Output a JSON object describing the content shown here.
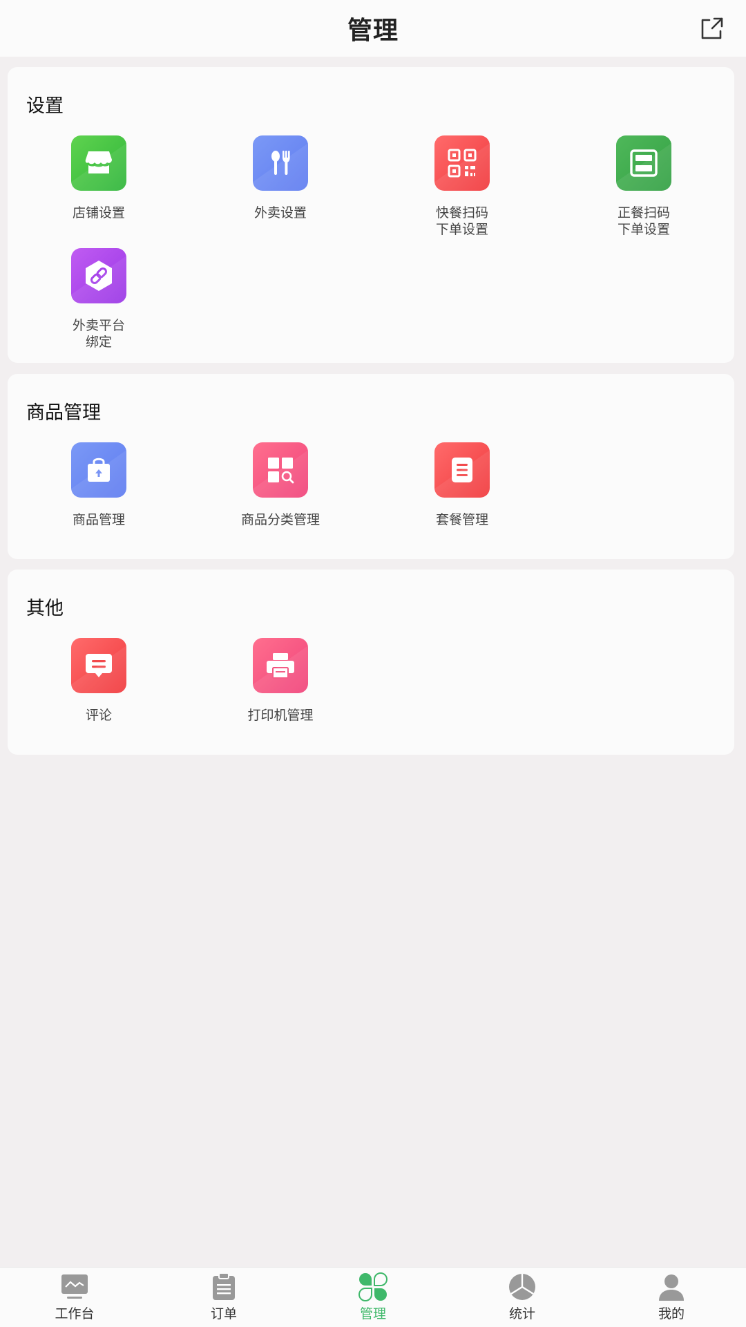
{
  "header": {
    "title": "管理",
    "share_icon": "share-icon"
  },
  "sections": [
    {
      "title": "设置",
      "items": [
        {
          "label": "店铺设置",
          "icon": "shop-icon",
          "color": "#3dc046"
        },
        {
          "label": "外卖设置",
          "icon": "spoon-fork-icon",
          "color": "#6f8cf4"
        },
        {
          "label": "快餐扫码\n下单设置",
          "icon": "qrcode-icon",
          "color": "#f5484b"
        },
        {
          "label": "正餐扫码\n下单设置",
          "icon": "scan-icon",
          "color": "#3fa94d"
        },
        {
          "label": "外卖平台\n绑定",
          "icon": "link-icon",
          "color": "#ac48ec"
        }
      ]
    },
    {
      "title": "商品管理",
      "items": [
        {
          "label": "商品管理",
          "icon": "bag-icon",
          "color": "#6f8cf4"
        },
        {
          "label": "商品分类管理",
          "icon": "category-search-icon",
          "color": "#f5557f"
        },
        {
          "label": "套餐管理",
          "icon": "list-doc-icon",
          "color": "#f5484b"
        }
      ]
    },
    {
      "title": "其他",
      "items": [
        {
          "label": "评论",
          "icon": "comment-icon",
          "color": "#f5484b"
        },
        {
          "label": "打印机管理",
          "icon": "printer-icon",
          "color": "#f5557f"
        }
      ]
    }
  ],
  "nav": [
    {
      "label": "工作台",
      "icon": "dashboard-icon",
      "active": false
    },
    {
      "label": "订单",
      "icon": "clipboard-icon",
      "active": false
    },
    {
      "label": "管理",
      "icon": "clover-icon",
      "active": true
    },
    {
      "label": "统计",
      "icon": "pie-chart-icon",
      "active": false
    },
    {
      "label": "我的",
      "icon": "user-icon",
      "active": false
    }
  ],
  "colors": {
    "accent": "#3fb86a",
    "background": "#f2eff0",
    "card": "#fbfbfb"
  }
}
